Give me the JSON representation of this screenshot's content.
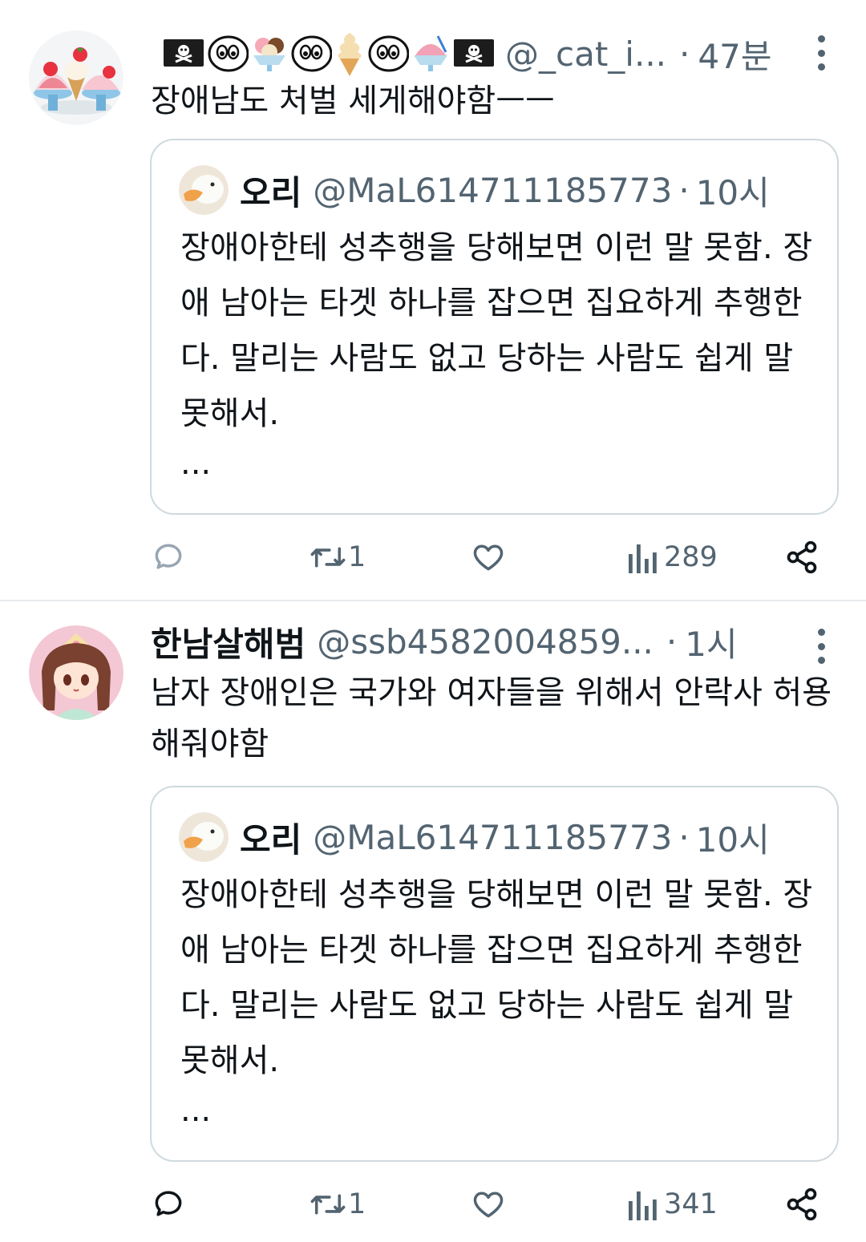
{
  "tweets": [
    {
      "user_name": "",
      "display_emojis": [
        "pirate-flag",
        "eyes-face",
        "ice-cream-bowl",
        "eyes-face",
        "soft-serve-cone",
        "eyes-face",
        "shaved-ice",
        "pirate-flag"
      ],
      "handle": "@_cat_i...",
      "separator": "·",
      "time": "47분",
      "text": "장애남도 처벌 세게해야함ㅡㅡ",
      "quote": {
        "name": "오리",
        "handle": "@MaL614711185773",
        "separator": "·",
        "time": "10시",
        "text": "장애아한테 성추행을 당해보면 이런 말 못함. 장애 남아는 타겟 하나를 잡으면 집요하게 추행한다. 말리는 사람도 없고 당하는 사람도 쉽게 말 못해서.",
        "ellipsis": "..."
      },
      "actions": {
        "reply": "",
        "retweet": "1",
        "like": "",
        "views": "289"
      }
    },
    {
      "user_name": "한남살해범",
      "handle": "@ssb4582004859...",
      "separator": "·",
      "time": "1시",
      "text": "남자 장애인은 국가와 여자들을 위해서 안락사 허용해줘야함",
      "quote": {
        "name": "오리",
        "handle": "@MaL614711185773",
        "separator": "·",
        "time": "10시",
        "text": "장애아한테 성추행을 당해보면 이런 말 못함. 장애 남아는 타겟 하나를 잡으면 집요하게 추행한다. 말리는 사람도 없고 당하는 사람도 쉽게 말 못해서.",
        "ellipsis": "..."
      },
      "actions": {
        "reply": "",
        "retweet": "1",
        "like": "",
        "views": "341"
      }
    }
  ],
  "colors": {
    "text_primary": "#0f1419",
    "text_secondary": "#536471",
    "border": "#cfd9de",
    "divider": "#e8ebee"
  }
}
